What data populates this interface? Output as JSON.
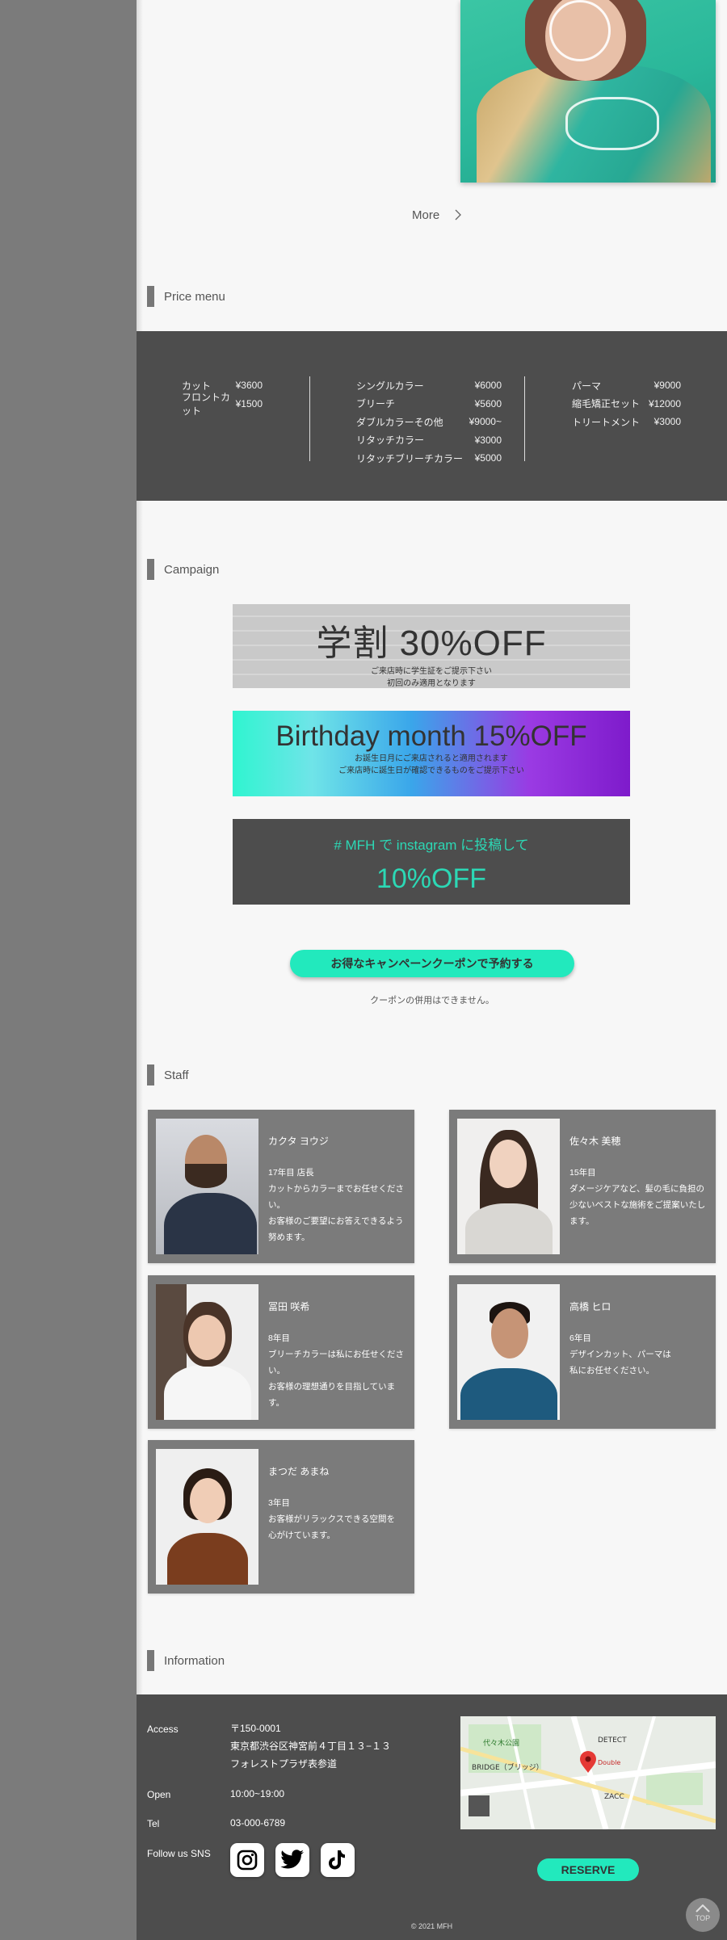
{
  "more": {
    "label": "More"
  },
  "price": {
    "title": "Price menu",
    "col1": [
      {
        "item": "カット",
        "price": "¥3600"
      },
      {
        "item": "フロントカット",
        "price": "¥1500"
      }
    ],
    "col2": [
      {
        "item": "シングルカラー",
        "price": "¥6000"
      },
      {
        "item": "ブリーチ",
        "price": "¥5600"
      },
      {
        "item": "ダブルカラーその他",
        "price": "¥9000~"
      },
      {
        "item": "リタッチカラー",
        "price": "¥3000"
      },
      {
        "item": "リタッチブリーチカラー",
        "price": "¥5000"
      }
    ],
    "col3": [
      {
        "item": "パーマ",
        "price": "¥9000"
      },
      {
        "item": "縮毛矯正セット",
        "price": "¥12000"
      },
      {
        "item": "トリートメント",
        "price": "¥3000"
      }
    ]
  },
  "campaign": {
    "title": "Campaign",
    "c1": {
      "big": "学割 30%OFF",
      "line1": "ご来店時に学生証をご提示下さい",
      "line2": "初回のみ適用となります"
    },
    "c2": {
      "big": "Birthday month 15%OFF",
      "line1": "お誕生日月にご来店されると適用されます",
      "line2": "ご来店時に誕生日が確認できるものをご提示下さい"
    },
    "c3": {
      "line1": "# MFH で instagram に投稿して",
      "big": "10%OFF"
    },
    "button": "お得なキャンペーンクーポンで予約する",
    "note": "クーポンの併用はできません。"
  },
  "staff": {
    "title": "Staff",
    "members": [
      {
        "name": "カクタ ヨウジ",
        "desc": "17年目 店長\nカットからカラーまでお任せください。\nお客様のご要望にお答えできるよう努めます。"
      },
      {
        "name": "佐々木 美穂",
        "desc": "15年目\nダメージケアなど、髪の毛に負担の少ないベストな施術をご提案いたします。"
      },
      {
        "name": "冨田 咲希",
        "desc": "8年目\nブリーチカラーは私にお任せください。\nお客様の理想通りを目指しています。"
      },
      {
        "name": "高橋 ヒロ",
        "desc": "6年目\nデザインカット、パーマは\n私にお任せください。"
      },
      {
        "name": "まつだ あまね",
        "desc": "3年目\nお客様がリラックスできる空間を\n心がけています。"
      }
    ]
  },
  "info": {
    "title": "Information",
    "access_label": "Access",
    "postal": "〒150-0001",
    "address1": "東京都渋谷区神宮前４丁目１３−１３",
    "address2": "フォレストプラザ表参道",
    "open_label": "Open",
    "open_value": "10:00~19:00",
    "tel_label": "Tel",
    "tel_value": "03-000-6789",
    "sns_label": "Follow us SNS",
    "reserve": "RESERVE",
    "copyright": "© 2021 MFH",
    "top": "TOP",
    "map_labels": [
      "代々木公園",
      "DETECT",
      "BRIDGE（ブリッジ）",
      "ZACC",
      "Double"
    ]
  }
}
